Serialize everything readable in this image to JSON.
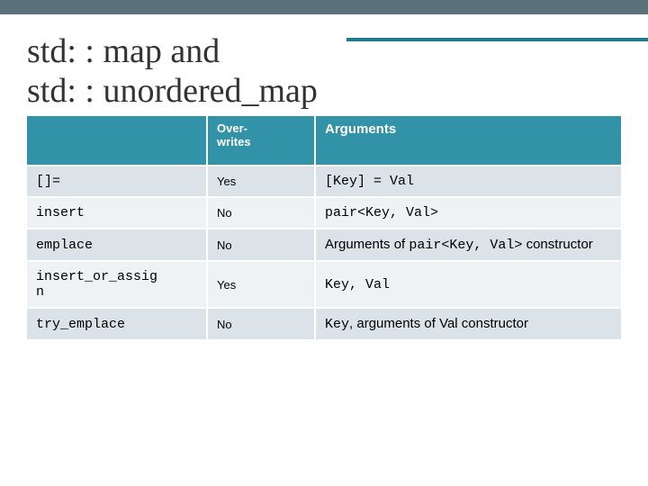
{
  "slide": {
    "title_line1": "std: : map and",
    "title_line2": "std: : unordered_map"
  },
  "table": {
    "headers": {
      "method": "",
      "overwrites_line1": "Over-",
      "overwrites_line2": "writes",
      "arguments": "Arguments"
    },
    "rows": [
      {
        "method": "[]=",
        "overwrites": "Yes",
        "arguments": "[Key] = Val",
        "args_type": "mono"
      },
      {
        "method": "insert",
        "overwrites": "No",
        "arguments": "pair<Key, Val>",
        "args_type": "mono"
      },
      {
        "method": "emplace",
        "overwrites": "No",
        "args_prefix": "Arguments of ",
        "args_mono": "pair<Key, Val>",
        "args_suffix": " constructor",
        "args_type": "mixed"
      },
      {
        "method_line1": "insert_or_assig",
        "method_line2": "n",
        "overwrites": "Yes",
        "args_mono": "Key, Val",
        "args_type": "mono-plain"
      },
      {
        "method": "try_emplace",
        "overwrites": "No",
        "args_mono": "Key",
        "args_suffix": ", arguments of Val constructor",
        "args_type": "mixed2"
      }
    ]
  }
}
